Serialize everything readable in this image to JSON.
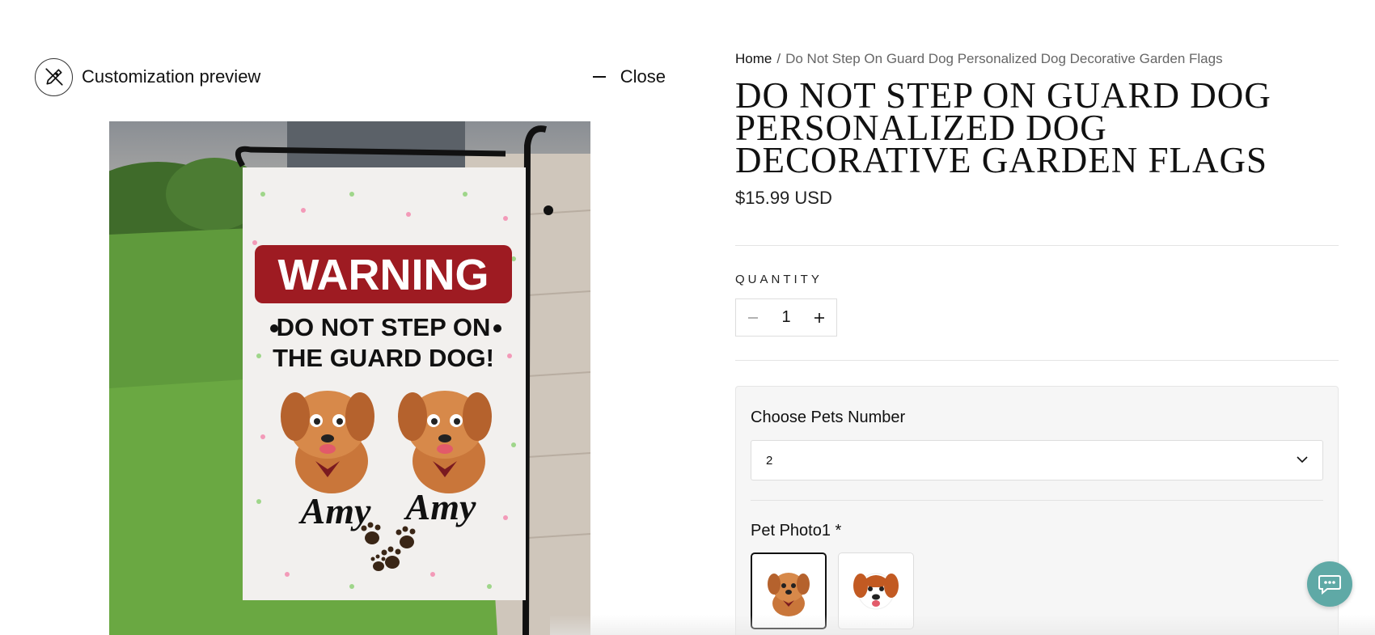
{
  "preview": {
    "title": "Customization preview",
    "close_label": "Close",
    "icon": "edit-off-icon"
  },
  "breadcrumb": {
    "home": "Home",
    "separator": "/",
    "current": "Do Not Step On Guard Dog Personalized Dog Decorative Garden Flags"
  },
  "product": {
    "title": "Do Not Step On Guard Dog Personalized Dog Decorative Garden Flags",
    "price": "$15.99 USD"
  },
  "flag": {
    "warning": "WARNING",
    "line1": "DO NOT STEP ON",
    "line2": "THE GUARD DOG!",
    "name1": "Amy",
    "name2": "Amy"
  },
  "quantity": {
    "label": "QUANTITY",
    "value": "1",
    "minus_icon": "minus-icon",
    "plus_icon": "plus-icon"
  },
  "customization": {
    "pets_label": "Choose Pets Number",
    "pets_value": "2",
    "photo_label": "Pet Photo1 *"
  },
  "colors": {
    "accent": "#5fa9a6",
    "warning_red": "#9e1b22"
  }
}
